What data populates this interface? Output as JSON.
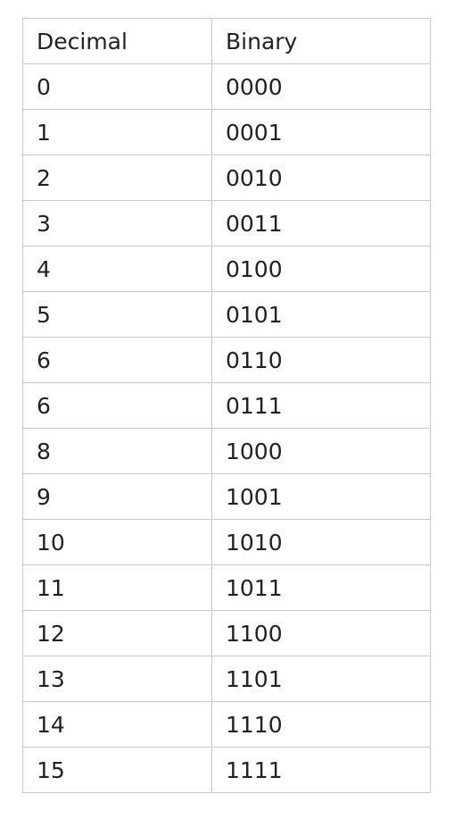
{
  "table": {
    "headers": [
      "Decimal",
      "Binary"
    ],
    "rows": [
      [
        "0",
        "0000"
      ],
      [
        "1",
        "0001"
      ],
      [
        "2",
        "0010"
      ],
      [
        "3",
        "0011"
      ],
      [
        "4",
        "0100"
      ],
      [
        "5",
        "0101"
      ],
      [
        "6",
        "0110"
      ],
      [
        "6",
        "0111"
      ],
      [
        "8",
        "1000"
      ],
      [
        "9",
        "1001"
      ],
      [
        "10",
        "1010"
      ],
      [
        "11",
        "1011"
      ],
      [
        "12",
        "1100"
      ],
      [
        "13",
        "1101"
      ],
      [
        "14",
        "1110"
      ],
      [
        "15",
        "1111"
      ]
    ]
  }
}
